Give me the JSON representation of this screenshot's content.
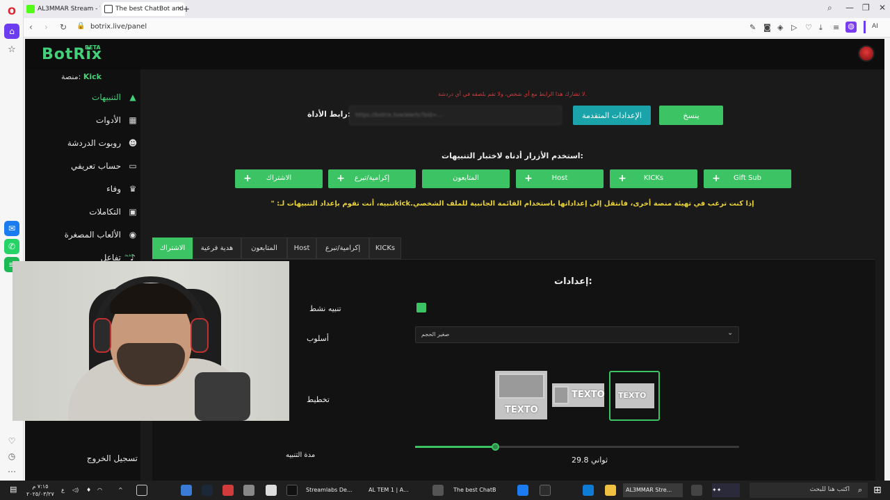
{
  "browser": {
    "tabs": [
      {
        "title": "AL3MMAR Stream - Watc",
        "fav_color": "#53fc18"
      },
      {
        "title": "The best ChatBot and Wi",
        "fav_color": "#ffffff"
      }
    ],
    "url": "botrix.live/panel",
    "new_tab": "+",
    "ai_label": "AI"
  },
  "app": {
    "logo": "BotRix",
    "beta": "BETA",
    "platform_label": "منصة:",
    "platform_value": "Kick",
    "sidebar": [
      {
        "label": "التنبيهات",
        "icon": "warning-icon",
        "glyph": "▲",
        "active": true
      },
      {
        "label": "الأدوات",
        "icon": "grid-icon",
        "glyph": "▦"
      },
      {
        "label": "روبوت الدردشة",
        "icon": "robot-icon",
        "glyph": "☻"
      },
      {
        "label": "حساب تعريفي",
        "icon": "id-card-icon",
        "glyph": "▭"
      },
      {
        "label": "وفاء",
        "icon": "trophy-icon",
        "glyph": "♛"
      },
      {
        "label": "التكاملات",
        "icon": "integrations-icon",
        "glyph": "▣"
      },
      {
        "label": "الألعاب المصغرة",
        "icon": "gamepad-icon",
        "glyph": "◉"
      },
      {
        "label": "تفاعل",
        "icon": "music-icon",
        "glyph": "♪"
      }
    ],
    "new_badge": "جديد",
    "logout": "تسجيل الخروج",
    "warning": "لا تشارك هذا الرابط مع أي شخص، ولا تقم بلصقه في أي دردشة.",
    "widget_link_label": "رابط الأداة:",
    "widget_link_value": "https://botrix.live/alerts?bid=...",
    "advanced_settings": "الإعدادات المتقدمة",
    "copy": "ينسخ",
    "test_label": "استخدم الأزرار أدناه لاختبار التنبيهات:",
    "test_buttons": [
      {
        "label": "Gift Sub",
        "plus": true
      },
      {
        "label": "KICKs",
        "plus": true
      },
      {
        "label": "Host",
        "plus": true
      },
      {
        "label": "المتابعون",
        "plus": false
      },
      {
        "label": "إكرامية/تبرع",
        "plus": true
      },
      {
        "label": "الاشتراك",
        "plus": true
      }
    ],
    "kick_info": "إذا كنت ترغب في تهيئة منصة أخرى، فانتقل إلى إعداداتها باستخدام القائمة الجانبية للملف الشخصي.kickتنبيه، أنت تقوم بإعداد التنبيهات لـ: \"",
    "alert_tabs": [
      {
        "label": "الاشتراك",
        "active": true
      },
      {
        "label": "هدية فرعية"
      },
      {
        "label": "المتابعون"
      },
      {
        "label": "Host"
      },
      {
        "label": "إكرامية/تبرع"
      },
      {
        "label": "KICKs"
      }
    ],
    "settings_title": "إعدادات:",
    "notify_label": "تنبيه نشط",
    "style_label": "أسلوب",
    "style_value": "صغير الحجم",
    "layout_label": "تخطيط",
    "layout_text": "TEXTO",
    "duration_label": "مدة التنبيه",
    "duration_value": "29.8",
    "duration_unit": "ثواني",
    "duration_fraction": 0.246
  },
  "taskbar": {
    "search_placeholder": "اكتب هنا للبحث",
    "items": [
      "AL3MMAR Stre...",
      "The best ChatB",
      "AL TEM 1 | A...",
      "Streamlabs De..."
    ],
    "time": "٧:١٥ م",
    "date": "٢٠٢٥/٠٣/٢٧",
    "lang": "ع"
  },
  "colors": {
    "accent": "#3cc464",
    "teal": "#1aa3a8",
    "warning": "#d23b3b",
    "info": "#e8d23a"
  }
}
